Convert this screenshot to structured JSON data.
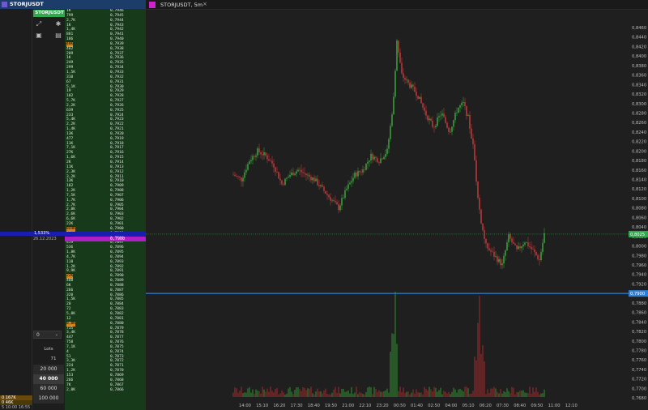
{
  "left_panel": {
    "tab_title": "STORJUSDT",
    "badge": "STORJUSDT",
    "ladder_rows": [
      [
        "1K",
        "0,7946"
      ],
      [
        "799",
        "0,7945"
      ],
      [
        "2,7K",
        "0,7944"
      ],
      [
        "1K",
        "0,7943"
      ],
      [
        "1,4K",
        "0,7942"
      ],
      [
        "881",
        "0,7941"
      ],
      [
        "186",
        "0,7940"
      ],
      [
        "48K",
        "0,7939"
      ],
      [
        "482",
        "0,7938"
      ],
      [
        "209",
        "0,7937"
      ],
      [
        "1K",
        "0,7936"
      ],
      [
        "249",
        "0,7935"
      ],
      [
        "299",
        "0,7934"
      ],
      [
        "1,5K",
        "0,7933"
      ],
      [
        "310",
        "0,7932"
      ],
      [
        "67",
        "0,7931"
      ],
      [
        "5,1K",
        "0,7930"
      ],
      [
        "19",
        "0,7929"
      ],
      [
        "102",
        "0,7928"
      ],
      [
        "5,7K",
        "0,7927"
      ],
      [
        "2,2K",
        "0,7926"
      ],
      [
        "639",
        "0,7925"
      ],
      [
        "233",
        "0,7924"
      ],
      [
        "5,4K",
        "0,7923"
      ],
      [
        "2,2K",
        "0,7922"
      ],
      [
        "1,4K",
        "0,7921"
      ],
      [
        "13K",
        "0,7920"
      ],
      [
        "477",
        "0,7919"
      ],
      [
        "11K",
        "0,7918"
      ],
      [
        "7,1K",
        "0,7917"
      ],
      [
        "27K",
        "0,7916"
      ],
      [
        "1,6K",
        "0,7915"
      ],
      [
        "2K",
        "0,7914"
      ],
      [
        "11K",
        "0,7913"
      ],
      [
        "2,3K",
        "0,7912"
      ],
      [
        "3,2K",
        "0,7911"
      ],
      [
        "13K",
        "0,7910"
      ],
      [
        "182",
        "0,7909"
      ],
      [
        "1,2K",
        "0,7908"
      ],
      [
        "7,5K",
        "0,7907"
      ],
      [
        "1,7K",
        "0,7906"
      ],
      [
        "2,7K",
        "0,7905"
      ],
      [
        "2,8K",
        "0,7904"
      ],
      [
        "2,6K",
        "0,7903"
      ],
      [
        "6,6K",
        "0,7902"
      ],
      [
        "22K",
        "0,7901"
      ],
      [
        "844K",
        "0,7900"
      ],
      [
        "1K",
        "0,7899"
      ],
      [
        "57K",
        "0,7898"
      ],
      [
        "459",
        "0,7897"
      ],
      [
        "536",
        "0,7896"
      ],
      [
        "1,8K",
        "0,7895"
      ],
      [
        "4,7K",
        "0,7894"
      ],
      [
        "118",
        "0,7893"
      ],
      [
        "1,2K",
        "0,7892"
      ],
      [
        "9,9K",
        "0,7891"
      ],
      [
        "22K",
        "0,7890"
      ],
      [
        "408",
        "0,7889"
      ],
      [
        "6K",
        "0,7888"
      ],
      [
        "266",
        "0,7887"
      ],
      [
        "320",
        "0,7886"
      ],
      [
        "1,5K",
        "0,7885"
      ],
      [
        "20",
        "0,7884"
      ],
      [
        "72",
        "0,7883"
      ],
      [
        "5,8K",
        "0,7882"
      ],
      [
        "12",
        "0,7881"
      ],
      [
        "8,8K",
        "0,7880"
      ],
      [
        "735",
        "0,7879"
      ],
      [
        "3,4K",
        "0,7878"
      ],
      [
        "447",
        "0,7877"
      ],
      [
        "758",
        "0,7876"
      ],
      [
        "7,1K",
        "0,7875"
      ],
      [
        "4",
        "0,7874"
      ],
      [
        "51",
        "0,7873"
      ],
      [
        "3,3K",
        "0,7872"
      ],
      [
        "224",
        "0,7871"
      ],
      [
        "1,2K",
        "0,7870"
      ],
      [
        "153",
        "0,7869"
      ],
      [
        "266",
        "0,7868"
      ],
      [
        "7K",
        "0,7867"
      ],
      [
        "2,8K",
        "0,7866"
      ]
    ],
    "current_percent": "1,533%",
    "current_date": "26.12.2023",
    "current_price": "0,7900",
    "lots_select": "0",
    "lots_label": "Lots",
    "lots_value": "71",
    "lot_buttons": [
      "20 000",
      "40 000",
      "60 000",
      "100 000"
    ],
    "bottom_rows": [
      "0 167K",
      "0 46K",
      "5 10:00 16:55"
    ]
  },
  "chart": {
    "tab_title": "STORJUSDT, 5m",
    "close_label": "×",
    "price_labels": [
      "0,8460",
      "0,8440",
      "0,8420",
      "0,8400",
      "0,8380",
      "0,8360",
      "0,8340",
      "0,8320",
      "0,8300",
      "0,8280",
      "0,8260",
      "0,8240",
      "0,8220",
      "0,8200",
      "0,8180",
      "0,8160",
      "0,8140",
      "0,8120",
      "0,8100",
      "0,8080",
      "0,8060",
      "0,8040",
      "0,8020",
      "0,8000",
      "0,7980",
      "0,7960",
      "0,7940",
      "0,7920",
      "0,7900",
      "0,7880",
      "0,7860",
      "0,7840",
      "0,7820",
      "0,7800",
      "0,7780",
      "0,7760",
      "0,7740",
      "0,7720",
      "0,7700",
      "0,7680"
    ],
    "time_labels": [
      "14:00",
      "15:10",
      "16:20",
      "17:30",
      "18:40",
      "19:50",
      "21:00",
      "22:10",
      "23:20",
      "00:50",
      "01:40",
      "02:50",
      "04:00",
      "05:10",
      "06:20",
      "07:30",
      "08:40",
      "09:50",
      "11:00",
      "12:10"
    ],
    "current_price_tag": "0,8025",
    "level_price_tag": "0,7900",
    "colors": {
      "up": "#3fae3f",
      "down": "#d23c3c",
      "level": "#2d7fd3",
      "current": "#2fa84f"
    }
  }
}
